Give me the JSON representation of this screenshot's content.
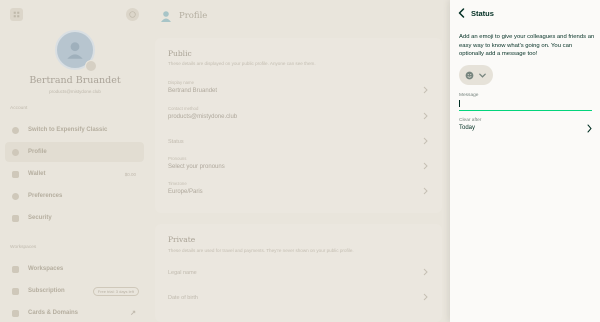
{
  "sidebar": {
    "user": {
      "name": "Bertrand Bruandet",
      "email": "products@mistydone.club"
    },
    "account_section": "Account",
    "account_items": [
      {
        "label": "Switch to Expensify Classic",
        "icon": "switch-icon"
      },
      {
        "label": "Profile",
        "icon": "profile-icon",
        "active": true
      },
      {
        "label": "Wallet",
        "icon": "wallet-icon",
        "badge": "$0.00"
      },
      {
        "label": "Preferences",
        "icon": "gear-icon"
      },
      {
        "label": "Security",
        "icon": "lock-icon"
      }
    ],
    "workspaces_section": "Workspaces",
    "workspace_items": [
      {
        "label": "Workspaces",
        "icon": "building-icon"
      },
      {
        "label": "Subscription",
        "icon": "card-icon",
        "pill": "Free trial: 3 days left"
      },
      {
        "label": "Cards & Domains",
        "icon": "domain-icon"
      }
    ]
  },
  "main": {
    "title": "Profile",
    "public_card": {
      "title": "Public",
      "description": "These details are displayed on your public profile. Anyone can see them.",
      "fields": [
        {
          "label": "Display name",
          "value": "Bertrand Bruandet"
        },
        {
          "label": "Contact method",
          "value": "products@mistydone.club"
        },
        {
          "label": "",
          "value": "Status"
        },
        {
          "label": "Pronouns",
          "value": "Select your pronouns"
        },
        {
          "label": "Timezone",
          "value": "Europe/Paris"
        }
      ]
    },
    "private_card": {
      "title": "Private",
      "description": "These details are used for travel and payments. They're never shown on your public profile.",
      "fields": [
        {
          "value": "Legal name"
        },
        {
          "value": "Date of birth"
        }
      ]
    }
  },
  "panel": {
    "title": "Status",
    "description": "Add an emoji to give your colleagues and friends an easy way to know what's going on. You can optionally add a message too!",
    "message_label": "Message",
    "message_value": "",
    "clear_after_label": "Clear after",
    "clear_after_value": "Today"
  },
  "colors": {
    "accent_green": "#03d47c",
    "text_dark": "#002e22",
    "overlay_bg": "#e9e5dc"
  }
}
